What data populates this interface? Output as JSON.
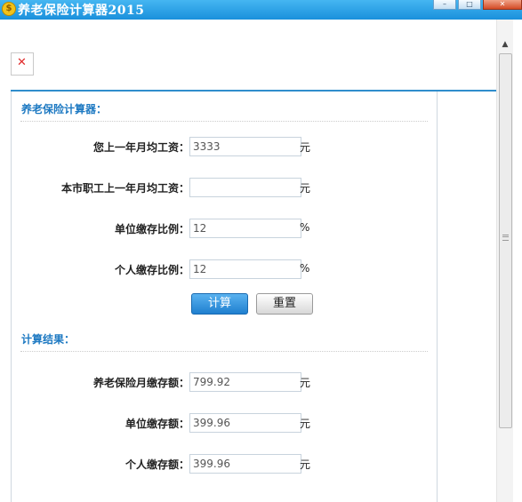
{
  "window": {
    "title": "养老保险计算器2015",
    "icon": "dollar-coin-icon",
    "controls": [
      "minimize-icon",
      "maximize-icon",
      "close-icon"
    ]
  },
  "calculator": {
    "section_title": "养老保险计算器：",
    "fields": [
      {
        "label": "您上一年月均工资：",
        "value": "3333",
        "unit": "元"
      },
      {
        "label": "本市职工上一年月均工资：",
        "value": "",
        "unit": "元"
      },
      {
        "label": "单位缴存比例：",
        "value": "12",
        "unit": "%"
      },
      {
        "label": "个人缴存比例：",
        "value": "12",
        "unit": "%"
      }
    ],
    "calc_button": "计算",
    "reset_button": "重置"
  },
  "results": {
    "section_title": "计算结果：",
    "fields": [
      {
        "label": "养老保险月缴存额：",
        "value": "799.92",
        "unit": "元"
      },
      {
        "label": "单位缴存额：",
        "value": "399.96",
        "unit": "元"
      },
      {
        "label": "个人缴存额：",
        "value": "399.96",
        "unit": "元"
      }
    ]
  },
  "colors": {
    "titlebar": "#1a90dc",
    "accent": "#1d79c2",
    "primary_button": "#2f8dcc"
  }
}
